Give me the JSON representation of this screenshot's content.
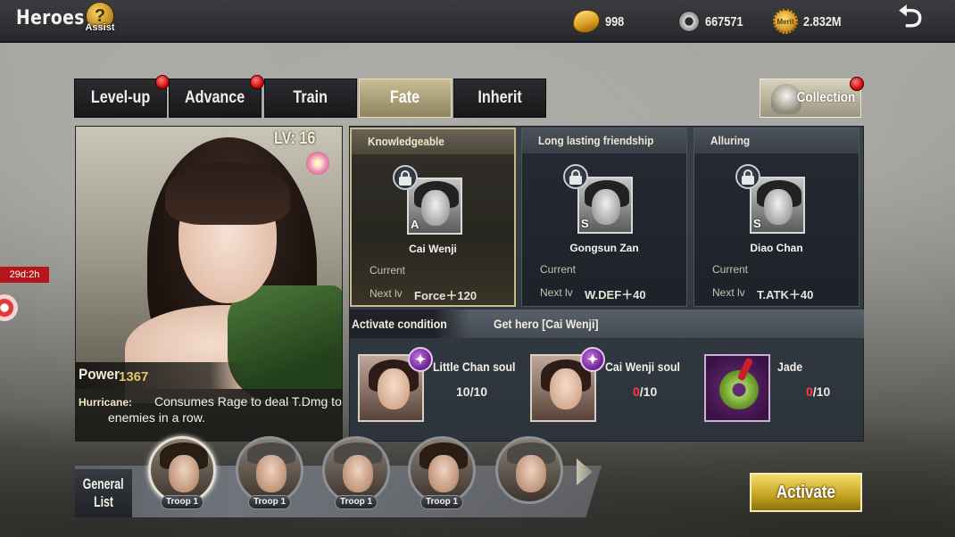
{
  "header": {
    "title": "Heroes",
    "assist_label": "Assist",
    "assist_symbol": "?",
    "gold": "998",
    "silver": "667571",
    "merit": "2.832M",
    "merit_icon_text": "Merit",
    "back_symbol": "⮌"
  },
  "side": {
    "timer": "29d:2h"
  },
  "tabs": [
    {
      "label": "Level-up",
      "alert": true
    },
    {
      "label": "Advance",
      "alert": true
    },
    {
      "label": "Train",
      "alert": false
    },
    {
      "label": "Fate",
      "alert": false,
      "active": true
    },
    {
      "label": "Inherit",
      "alert": false
    }
  ],
  "collection": {
    "label": "Collection",
    "alert": true
  },
  "hero": {
    "level": "LV: 16",
    "power_label": "Power",
    "power_value": "1367",
    "skill_name": "Hurricane:",
    "skill_desc": "Consumes Rage to deal T.Dmg to enemies in a row."
  },
  "fates": [
    {
      "title": "Knowledgeable",
      "hero": "Cai Wenji",
      "grade": "A",
      "current_label": "Current",
      "next_label": "Next lv",
      "next_value": "Force＋120",
      "active": true,
      "locked": true
    },
    {
      "title": "Long lasting friendship",
      "hero": "Gongsun Zan",
      "grade": "S",
      "current_label": "Current",
      "next_label": "Next lv",
      "next_value": "W.DEF＋40",
      "active": false,
      "locked": true
    },
    {
      "title": "Alluring",
      "hero": "Diao Chan",
      "grade": "S",
      "current_label": "Current",
      "next_label": "Next lv",
      "next_value": "T.ATK＋40",
      "active": false,
      "locked": true
    }
  ],
  "condition": {
    "label": "Activate condition",
    "text": "Get hero [Cai Wenji]"
  },
  "requirements": [
    {
      "name": "Little Chan soul",
      "have": "10",
      "need": "/10",
      "ok": true,
      "type": "soul"
    },
    {
      "name": "Cai Wenji soul",
      "have": "0",
      "need": "/10",
      "ok": false,
      "type": "soul"
    },
    {
      "name": "Jade",
      "have": "0",
      "need": "/10",
      "ok": false,
      "type": "item"
    }
  ],
  "general_list": {
    "title_line1": "General",
    "title_line2": "List",
    "troops": [
      {
        "label": "Troop 1",
        "selected": true
      },
      {
        "label": "Troop 1",
        "selected": false
      },
      {
        "label": "Troop 1",
        "selected": false
      },
      {
        "label": "Troop 1",
        "selected": false
      },
      {
        "label": "",
        "selected": false
      }
    ]
  },
  "activate_label": "Activate",
  "colors": {
    "accent_gold": "#c5a220",
    "alert_red": "#d30f0f",
    "missing_red": "#ff3b3b",
    "active_tab": "#b3a77e"
  }
}
